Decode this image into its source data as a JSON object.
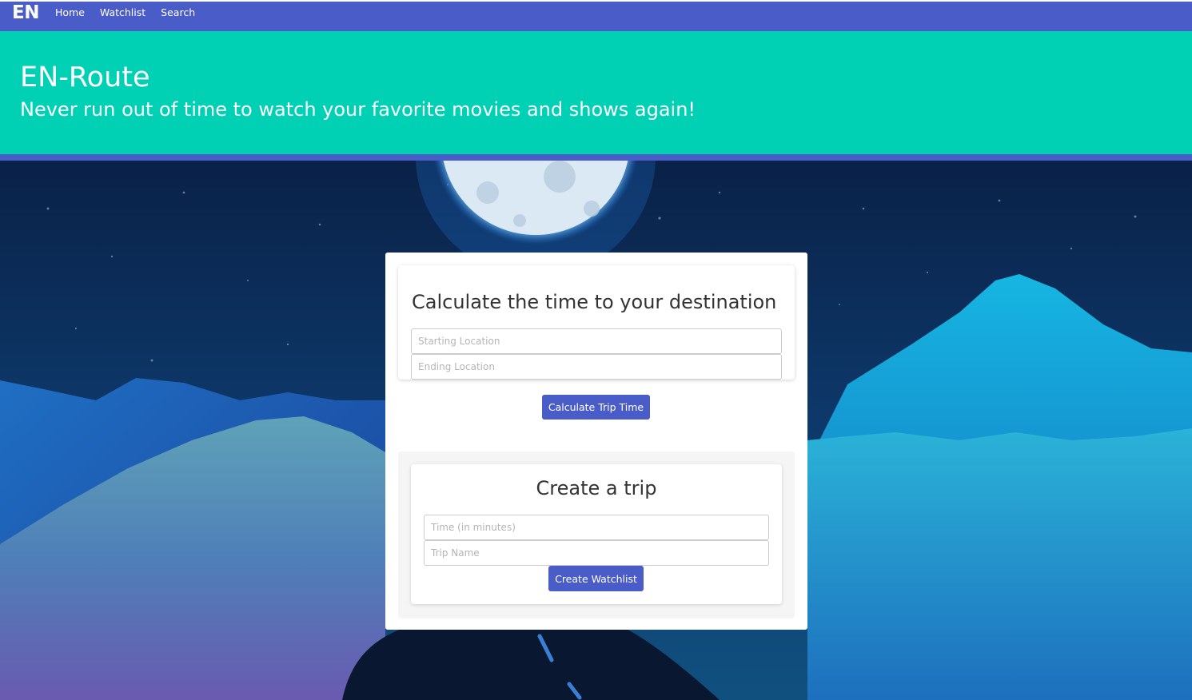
{
  "nav": {
    "brand": "EN",
    "links": [
      "Home",
      "Watchlist",
      "Search"
    ]
  },
  "hero": {
    "title": "EN-Route",
    "subtitle": "Never run out of time to watch your favorite movies and shows again!"
  },
  "calc_card": {
    "title": "Calculate the time to your destination",
    "start_placeholder": "Starting Location",
    "end_placeholder": "Ending Location",
    "button_label": "Calculate Trip Time"
  },
  "trip_card": {
    "title": "Create a trip",
    "time_placeholder": "Time (in minutes)",
    "name_placeholder": "Trip Name",
    "button_label": "Create Watchlist"
  },
  "colors": {
    "nav_bg": "#4a5cc7",
    "hero_bg": "#00d1b5",
    "button_bg": "#4a5cc7",
    "sky": "#0b2a55",
    "mountain": "#1a9fd6"
  }
}
